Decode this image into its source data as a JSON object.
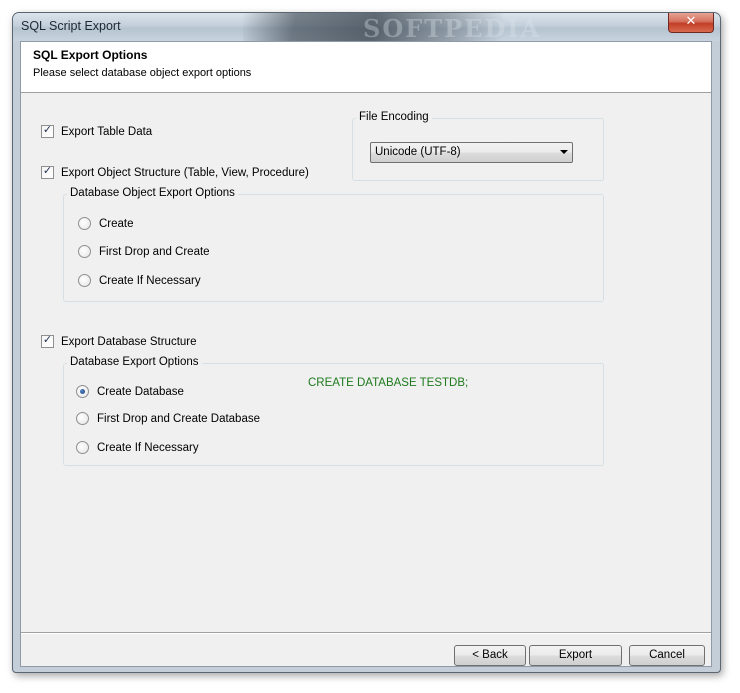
{
  "window": {
    "title": "SQL Script Export",
    "close_glyph": "✕",
    "watermark": "SOFTPEDIA"
  },
  "header": {
    "title": "SQL Export Options",
    "subtitle": "Please select database object export options"
  },
  "options": {
    "export_table_data": {
      "label": "Export Table Data",
      "checked": true
    },
    "export_object_structure": {
      "label": "Export Object Structure (Table, View, Procedure)",
      "checked": true
    },
    "export_database_structure": {
      "label": "Export Database Structure",
      "checked": true
    }
  },
  "file_encoding": {
    "caption": "File Encoding",
    "selected": "Unicode (UTF-8)"
  },
  "object_export_options": {
    "caption": "Database Object Export Options",
    "items": [
      {
        "label": "Create",
        "selected": false
      },
      {
        "label": "First Drop and Create",
        "selected": false
      },
      {
        "label": "Create If Necessary",
        "selected": false
      }
    ]
  },
  "database_export_options": {
    "caption": "Database Export Options",
    "items": [
      {
        "label": "Create Database",
        "selected": true
      },
      {
        "label": "First Drop and Create Database",
        "selected": false
      },
      {
        "label": "Create If Necessary",
        "selected": false
      }
    ]
  },
  "sql_preview": "CREATE DATABASE TESTDB;",
  "buttons": {
    "back": "< Back",
    "export": "Export",
    "cancel": "Cancel"
  },
  "colors": {
    "sql_preview": "#1d7a1d",
    "close_button": "#c23d26",
    "dialog_background": "#f0f0f0"
  }
}
